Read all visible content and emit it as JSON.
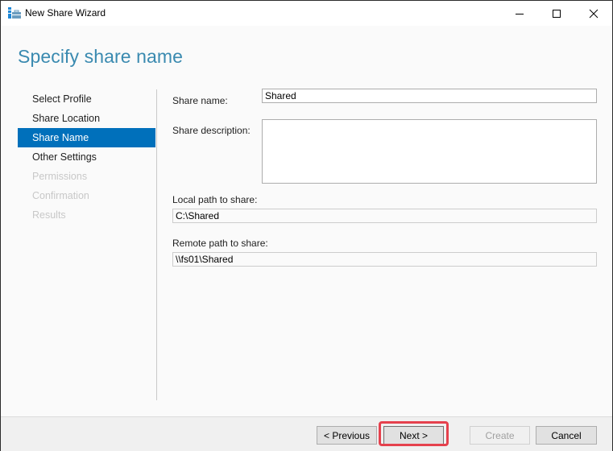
{
  "window": {
    "title": "New Share Wizard",
    "icon": "server-share-icon",
    "controls": [
      "minimize-icon",
      "maximize-icon",
      "close-icon"
    ]
  },
  "page": {
    "title": "Specify share name"
  },
  "nav": {
    "items": [
      {
        "label": "Select Profile",
        "state": "completed"
      },
      {
        "label": "Share Location",
        "state": "completed"
      },
      {
        "label": "Share Name",
        "state": "active"
      },
      {
        "label": "Other Settings",
        "state": "enabled"
      },
      {
        "label": "Permissions",
        "state": "disabled"
      },
      {
        "label": "Confirmation",
        "state": "disabled"
      },
      {
        "label": "Results",
        "state": "disabled"
      }
    ]
  },
  "form": {
    "share_name": {
      "label": "Share name:",
      "value": "Shared"
    },
    "share_description": {
      "label": "Share description:",
      "value": ""
    },
    "local_path": {
      "label": "Local path to share:",
      "value": "C:\\Shared"
    },
    "remote_path": {
      "label": "Remote path to share:",
      "value": "\\\\fs01\\Shared"
    }
  },
  "footer": {
    "previous_label": "< Previous",
    "next_label": "Next >",
    "create_label": "Create",
    "cancel_label": "Cancel",
    "highlight_color": "#e5414d"
  },
  "colors": {
    "accent": "#0070bb",
    "title": "#3a8ab0"
  }
}
